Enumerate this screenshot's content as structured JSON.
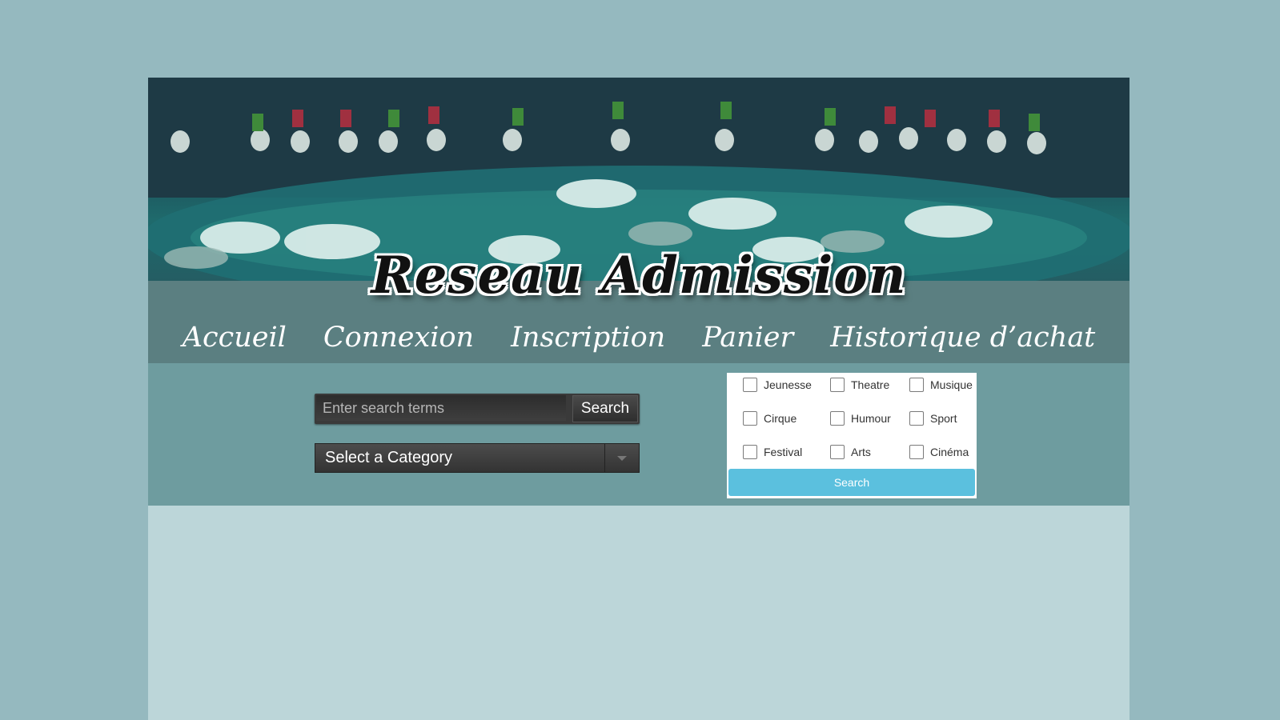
{
  "logo_text": "Reseau Admission",
  "nav": {
    "items": [
      "Accueil",
      "Connexion",
      "Inscription",
      "Panier",
      "Historique d’achat"
    ]
  },
  "search": {
    "placeholder": "Enter search terms",
    "button_label": "Search"
  },
  "category_select": {
    "selected": "Select a Category"
  },
  "filters": {
    "options": [
      "Jeunesse",
      "Theatre",
      "Musique",
      "Cirque",
      "Humour",
      "Sport",
      "Festival",
      "Arts",
      "Cinéma"
    ],
    "button_label": "Search"
  },
  "colors": {
    "background": "#95b9bf",
    "content": "#bcd6d9",
    "nav_band": "#5b7f81",
    "search_band": "#6e9c9f",
    "filter_button": "#5bc0de"
  }
}
